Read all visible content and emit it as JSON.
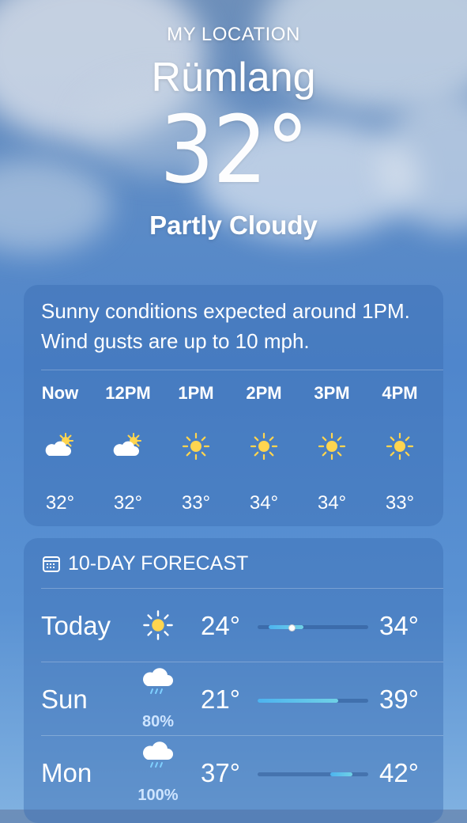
{
  "header": {
    "location_label": "MY LOCATION",
    "city": "Rümlang",
    "temperature": "32°",
    "condition": "Partly Cloudy"
  },
  "hourly": {
    "summary": "Sunny conditions expected around 1PM. Wind gusts are up to 10 mph.",
    "hours": [
      {
        "label": "Now",
        "icon": "partly-cloudy-icon",
        "temp": "32°"
      },
      {
        "label": "12PM",
        "icon": "partly-cloudy-icon",
        "temp": "32°"
      },
      {
        "label": "1PM",
        "icon": "sun-icon",
        "temp": "33°"
      },
      {
        "label": "2PM",
        "icon": "sun-icon",
        "temp": "34°"
      },
      {
        "label": "3PM",
        "icon": "sun-icon",
        "temp": "34°"
      },
      {
        "label": "4PM",
        "icon": "sun-icon",
        "temp": "33°"
      }
    ]
  },
  "forecast": {
    "title": "10-DAY FORECAST",
    "title_icon": "calendar-icon",
    "days": [
      {
        "day": "Today",
        "icon": "sun-icon",
        "precip": "",
        "low": "24°",
        "high": "34°",
        "current_marker": true
      },
      {
        "day": "Sun",
        "icon": "rain-cloud-icon",
        "precip": "80%",
        "low": "21°",
        "high": "39°",
        "current_marker": false
      },
      {
        "day": "Mon",
        "icon": "rain-cloud-icon",
        "precip": "100%",
        "low": "37°",
        "high": "42°",
        "current_marker": false
      }
    ]
  },
  "colors": {
    "sky_top": "#6d8fba",
    "sky_bottom": "#7fb0e0",
    "bar_fill_start": "#4db3ef",
    "bar_fill_end": "#6fd1e6",
    "precip_text": "#cde4ff"
  }
}
